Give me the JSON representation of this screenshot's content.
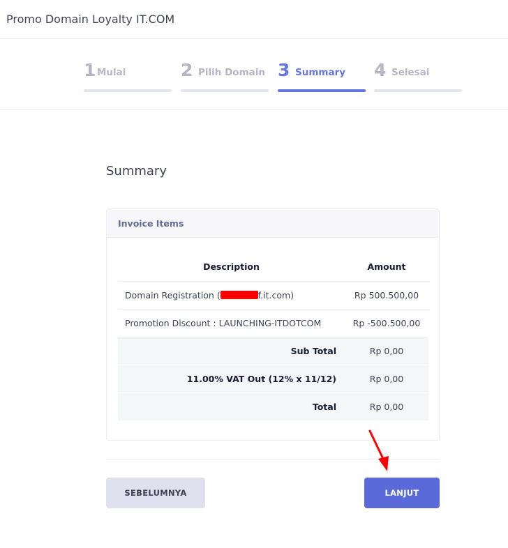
{
  "app": {
    "title": "Promo Domain Loyalty IT.COM"
  },
  "steps": [
    {
      "number": "1",
      "label": "Mulai",
      "active": false
    },
    {
      "number": "2",
      "label": "Pilih Domain",
      "active": false
    },
    {
      "number": "3",
      "label": "Summary",
      "active": true
    },
    {
      "number": "4",
      "label": "Selesai",
      "active": false
    }
  ],
  "summary": {
    "heading": "Summary"
  },
  "invoice": {
    "header": "Invoice Items",
    "columns": {
      "description": "Description",
      "amount": "Amount"
    },
    "items": [
      {
        "description_prefix": "Domain Registration (",
        "description_suffix": "f.it.com)",
        "amount": "Rp 500.500,00"
      },
      {
        "description": "Promotion Discount : LAUNCHING-ITDOTCOM",
        "amount": "Rp -500.500,00"
      }
    ],
    "totals": [
      {
        "label": "Sub Total",
        "amount": "Rp 0,00"
      },
      {
        "label": "11.00% VAT Out (12% x 11/12)",
        "amount": "Rp 0,00"
      },
      {
        "label": "Total",
        "amount": "Rp 0,00"
      }
    ]
  },
  "buttons": {
    "previous": "SEBELUMNYA",
    "next": "LANJUT"
  },
  "colors": {
    "accent": "#5b6ad9",
    "step_active": "#6575e2",
    "annotation": "#ff0000"
  }
}
